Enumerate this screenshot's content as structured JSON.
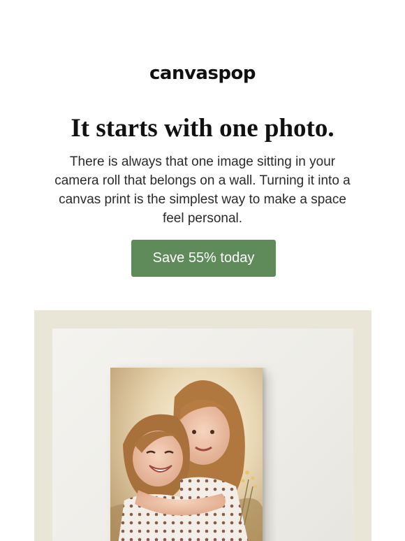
{
  "brand": {
    "logo_text": "canvaspop"
  },
  "hero_text": {
    "headline": "It starts with one photo.",
    "body": "There is always that one image sitting in your camera roll that belongs on a wall. Turning it into a canvas print is the simplest way to make a space feel personal."
  },
  "cta": {
    "label": "Save 55% today"
  },
  "colors": {
    "cta_green": "#5f8b5b",
    "hero_frame": "#e9e6d8",
    "wall": "#f2f1ed"
  }
}
